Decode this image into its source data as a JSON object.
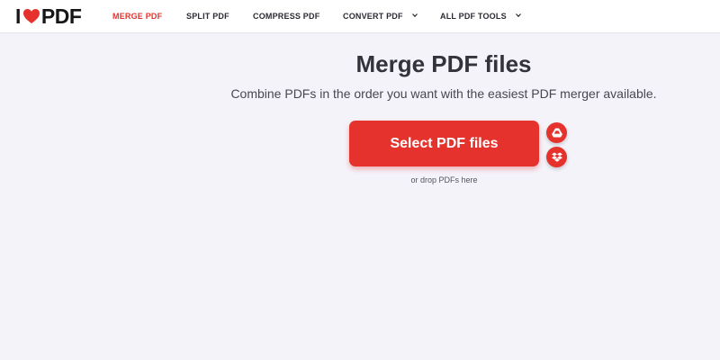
{
  "logo": {
    "left": "I",
    "right": "PDF",
    "heart_color": "#e5322d"
  },
  "nav": {
    "merge_pdf": "MERGE PDF",
    "split_pdf": "SPLIT PDF",
    "compress_pdf": "COMPRESS PDF",
    "convert_pdf": "CONVERT PDF",
    "all_pdf_tools": "ALL PDF TOOLS"
  },
  "main": {
    "title": "Merge PDF files",
    "subtitle": "Combine PDFs in the order you want with the easiest PDF merger available.",
    "select_button": "Select PDF files",
    "drop_hint": "or drop PDFs here"
  },
  "icons": {
    "upload_google_drive": "google-drive-icon",
    "upload_dropbox": "dropbox-icon"
  },
  "colors": {
    "accent": "#e5322d",
    "background": "#f4f3fa",
    "text": "#33333b"
  }
}
